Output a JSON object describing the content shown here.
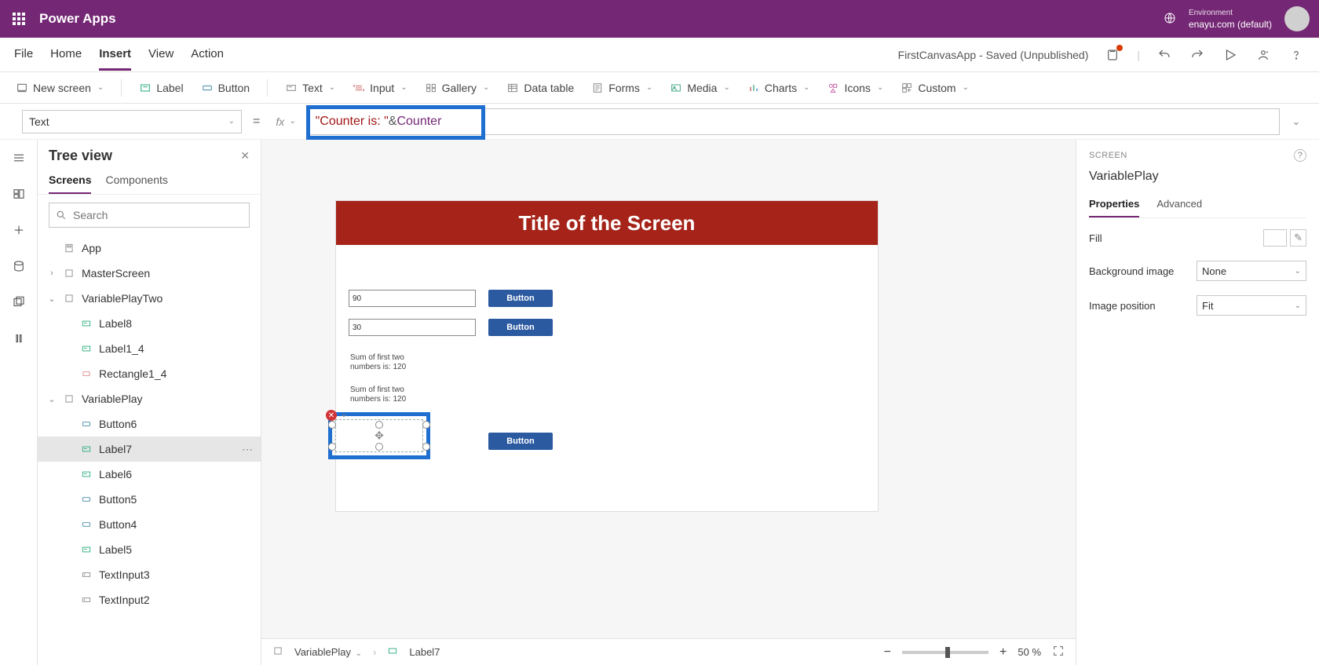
{
  "header": {
    "app_name": "Power Apps",
    "env_label": "Environment",
    "env_value": "enayu.com (default)"
  },
  "menubar": {
    "items": [
      "File",
      "Home",
      "Insert",
      "View",
      "Action"
    ],
    "active_index": 2,
    "app_status": "FirstCanvasApp - Saved (Unpublished)"
  },
  "ribbon": {
    "new_screen": "New screen",
    "label": "Label",
    "button": "Button",
    "text": "Text",
    "input": "Input",
    "gallery": "Gallery",
    "data_table": "Data table",
    "forms": "Forms",
    "media": "Media",
    "charts": "Charts",
    "icons": "Icons",
    "custom": "Custom"
  },
  "formula": {
    "property": "Text",
    "fx_label": "fx",
    "token_string": "\"Counter is: \"",
    "token_op": " & ",
    "token_var": "Counter"
  },
  "tree": {
    "title": "Tree view",
    "tab_screens": "Screens",
    "tab_components": "Components",
    "search_placeholder": "Search",
    "items": {
      "app": "App",
      "master": "MasterScreen",
      "vptwo": "VariablePlayTwo",
      "label8": "Label8",
      "label1_4": "Label1_4",
      "rect1_4": "Rectangle1_4",
      "vp": "VariablePlay",
      "button6": "Button6",
      "label7": "Label7",
      "label6": "Label6",
      "button5": "Button5",
      "button4": "Button4",
      "label5": "Label5",
      "ti3": "TextInput3",
      "ti2": "TextInput2"
    }
  },
  "canvas": {
    "screen_title": "Title of the Screen",
    "input1": "90",
    "input2": "30",
    "btn_label": "Button",
    "sum1_line1": "Sum of first two",
    "sum1_line2": "numbers is: 120",
    "sum2_line1": "Sum of first two",
    "sum2_line2": "numbers is: 120"
  },
  "status": {
    "breadcrumb_screen": "VariablePlay",
    "breadcrumb_control": "Label7",
    "zoom_value": "50",
    "zoom_unit": "%"
  },
  "props": {
    "header_label": "SCREEN",
    "screen_name": "VariablePlay",
    "tab_properties": "Properties",
    "tab_advanced": "Advanced",
    "fill_label": "Fill",
    "bgimg_label": "Background image",
    "bgimg_value": "None",
    "imgpos_label": "Image position",
    "imgpos_value": "Fit"
  }
}
